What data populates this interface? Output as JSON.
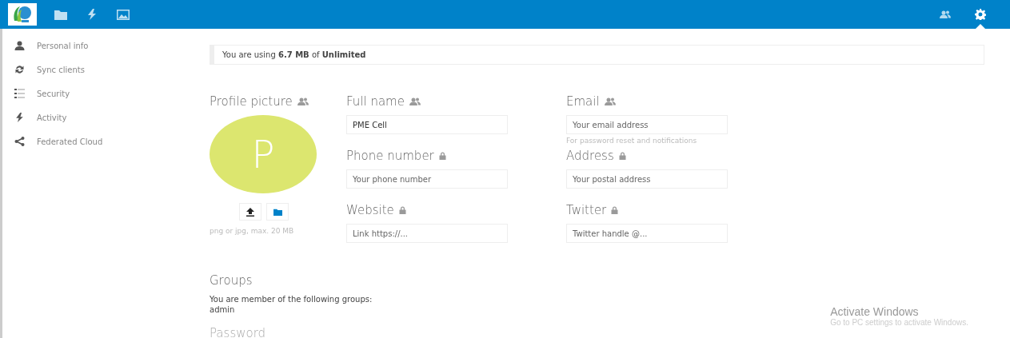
{
  "header": {
    "apps": [
      {
        "kind": "files"
      },
      {
        "kind": "activity"
      },
      {
        "kind": "gallery"
      }
    ],
    "right": [
      {
        "kind": "contacts",
        "selected": false
      },
      {
        "kind": "settings",
        "selected": true
      }
    ]
  },
  "sidebar": {
    "items": [
      {
        "kind": "user",
        "label": "Personal info"
      },
      {
        "kind": "sync",
        "label": "Sync clients"
      },
      {
        "kind": "list",
        "label": "Security"
      },
      {
        "kind": "activity",
        "label": "Activity"
      },
      {
        "kind": "share",
        "label": "Federated Cloud"
      }
    ]
  },
  "quota": "You are using **6.7 MB** of **Unlimited**",
  "profile_picture": {
    "heading": "Profile picture",
    "initial": "P",
    "hint": "png or jpg, max. 20 MB"
  },
  "fields": [
    {
      "heading": "Full name",
      "kind": "contacts",
      "value": "PME Cell"
    },
    {
      "heading": "Email",
      "kind": "contacts",
      "placeholder": "Your email address",
      "hint": "For password reset and notifications"
    },
    {
      "heading": "Phone number",
      "kind": "private",
      "placeholder": "Your phone number"
    },
    {
      "heading": "Address",
      "kind": "private",
      "placeholder": "Your postal address"
    },
    {
      "heading": "Website",
      "kind": "private",
      "placeholder": "Link https://..."
    },
    {
      "heading": "Twitter",
      "kind": "private",
      "placeholder": "Twitter handle @..."
    }
  ],
  "groups": {
    "heading": "Groups",
    "text": "You are member of the following groups:",
    "list": "admin"
  },
  "password_heading": "Password",
  "activation_notice": {
    "title": "Activate Windows",
    "text": "Go to PC settings to activate Windows."
  }
}
